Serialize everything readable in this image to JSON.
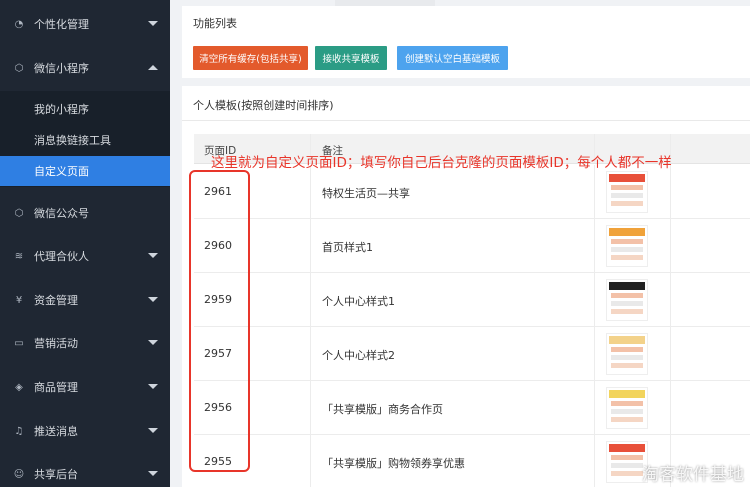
{
  "sidebar": {
    "items": [
      {
        "label": "个性化管理",
        "icon": "palette-icon",
        "glyph": "◔",
        "caret": "down"
      },
      {
        "label": "微信小程序",
        "icon": "cube-icon",
        "glyph": "⬡",
        "caret": "up"
      },
      {
        "label": "微信公众号",
        "icon": "cube-icon",
        "glyph": "⬡",
        "caret": ""
      },
      {
        "label": "代理合伙人",
        "icon": "layers-icon",
        "glyph": "≋",
        "caret": "down"
      },
      {
        "label": "资金管理",
        "icon": "yen-icon",
        "glyph": "¥",
        "caret": "down"
      },
      {
        "label": "营销活动",
        "icon": "card-icon",
        "glyph": "▭",
        "caret": "down"
      },
      {
        "label": "商品管理",
        "icon": "tag-icon",
        "glyph": "◈",
        "caret": "down"
      },
      {
        "label": "推送消息",
        "icon": "bell-icon",
        "glyph": "♫",
        "caret": "down"
      },
      {
        "label": "共享后台",
        "icon": "user-icon",
        "glyph": "☺",
        "caret": "down"
      }
    ],
    "sub_items": [
      {
        "label": "我的小程序",
        "active": false
      },
      {
        "label": "消息换链接工具",
        "active": false
      },
      {
        "label": "自定义页面",
        "active": true
      }
    ]
  },
  "function_panel": {
    "title": "功能列表",
    "buttons": {
      "clear_cache": "清空所有缓存(包括共享)",
      "receive_template": "接收共享模板",
      "create_default": "创建默认空白基础模板"
    }
  },
  "template_panel": {
    "title": "个人模板(按照创建时间排序)",
    "columns": {
      "id": "页面ID",
      "remark": "备注"
    },
    "rows": [
      {
        "id": "2961",
        "remark": "特权生活页—共享",
        "thumb_color": "#e8503a"
      },
      {
        "id": "2960",
        "remark": "首页样式1",
        "thumb_color": "#f0a23a"
      },
      {
        "id": "2959",
        "remark": "个人中心样式1",
        "thumb_color": "#222222"
      },
      {
        "id": "2957",
        "remark": "个人中心样式2",
        "thumb_color": "#f3d28a"
      },
      {
        "id": "2956",
        "remark": "「共享模版」商务合作页",
        "thumb_color": "#f2d45c"
      },
      {
        "id": "2955",
        "remark": "「共享模版」购物领券享优惠",
        "thumb_color": "#e8503a"
      }
    ]
  },
  "annotation": {
    "text": "这里就为自定义页面ID；填写你自己后台克隆的页面模板ID；每个人都不一样",
    "color": "#e8352a"
  },
  "watermark": "淘客软件基地",
  "colors": {
    "sidebar_bg": "#1f2733",
    "active_blue": "#2f7fe3",
    "btn_red": "#e35a2c",
    "btn_green": "#2b9c85",
    "btn_blue": "#4da3ee"
  }
}
